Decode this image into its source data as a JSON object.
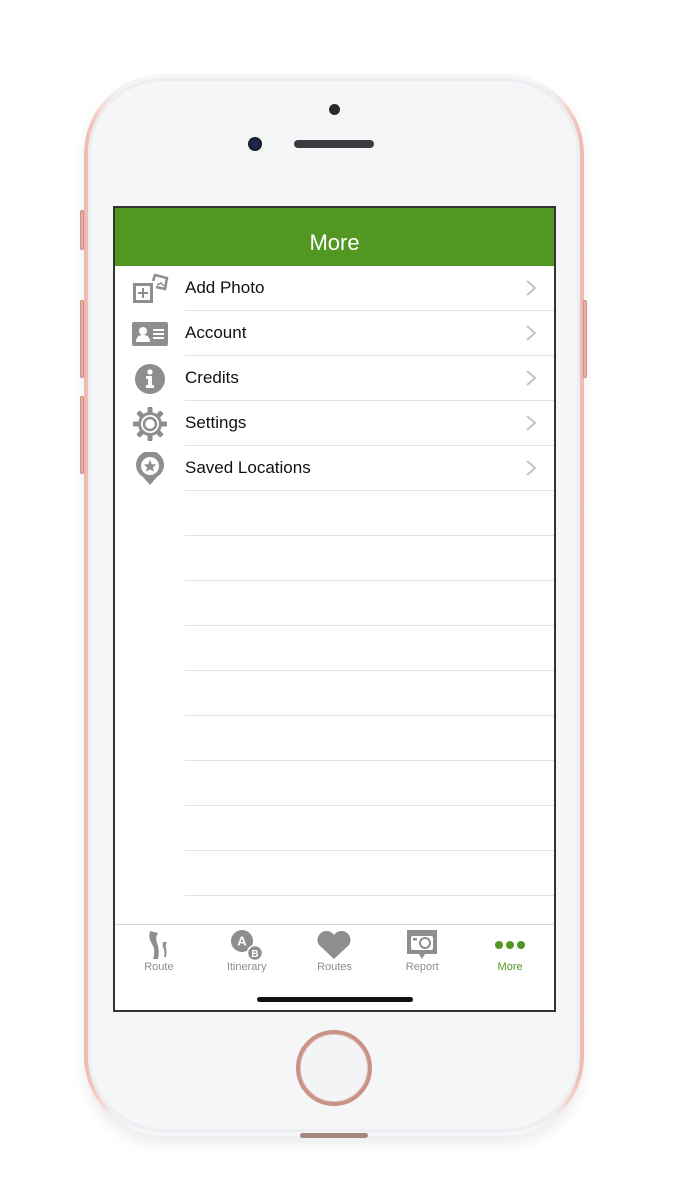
{
  "header": {
    "title": "More"
  },
  "menu": {
    "items": [
      {
        "label": "Add Photo",
        "icon": "add-photo-icon"
      },
      {
        "label": "Account",
        "icon": "account-card-icon"
      },
      {
        "label": "Credits",
        "icon": "info-icon"
      },
      {
        "label": "Settings",
        "icon": "gear-icon"
      },
      {
        "label": "Saved Locations",
        "icon": "saved-location-pin-icon"
      }
    ],
    "empty_rows": 9
  },
  "tabbar": {
    "tabs": [
      {
        "label": "Route",
        "icon": "route-icon",
        "active": false
      },
      {
        "label": "Itinerary",
        "icon": "itinerary-ab-icon",
        "active": false
      },
      {
        "label": "Routes",
        "icon": "heart-icon",
        "active": false
      },
      {
        "label": "Report",
        "icon": "report-camera-icon",
        "active": false
      },
      {
        "label": "More",
        "icon": "more-dots-icon",
        "active": true
      }
    ]
  },
  "colors": {
    "accent": "#519722",
    "icon_gray": "#8e8e8e",
    "text": "#111111",
    "phone_rose_gold": "#efb7ad"
  }
}
